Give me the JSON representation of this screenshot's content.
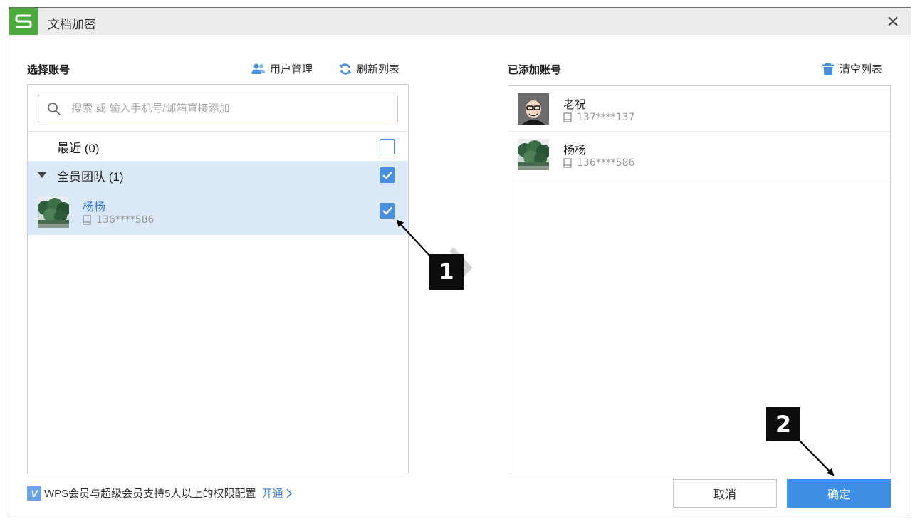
{
  "window": {
    "title": "文档加密",
    "logo_letter": "S"
  },
  "left": {
    "section_title": "选择账号",
    "user_manage_label": "用户管理",
    "refresh_label": "刷新列表",
    "search": {
      "placeholder": "搜索 或 输入手机号/邮箱直接添加",
      "value": ""
    },
    "recent": {
      "label": "最近 (0)",
      "checked": false
    },
    "team": {
      "label": "全员团队 (1)",
      "checked": true,
      "expanded": true
    },
    "members": [
      {
        "name": "杨杨",
        "phone": "136****586",
        "checked": true
      }
    ]
  },
  "right": {
    "section_title": "已添加账号",
    "clear_label": "清空列表",
    "added": [
      {
        "name": "老祝",
        "phone": "137****137"
      },
      {
        "name": "杨杨",
        "phone": "136****586"
      }
    ]
  },
  "footer": {
    "vip_icon": "V",
    "note": "WPS会员与超级会员支持5人以上的权限配置",
    "open_link": "开通",
    "cancel_label": "取消",
    "ok_label": "确定"
  },
  "annotations": {
    "marker_1": "1",
    "marker_2": "2"
  },
  "colors": {
    "logo_green": "#4aab3c",
    "selection_blue": "#dbe8f8",
    "checkbox_blue": "#4a8fdb",
    "primary_button": "#3e8fe6",
    "link_blue": "#3b7fd6"
  }
}
